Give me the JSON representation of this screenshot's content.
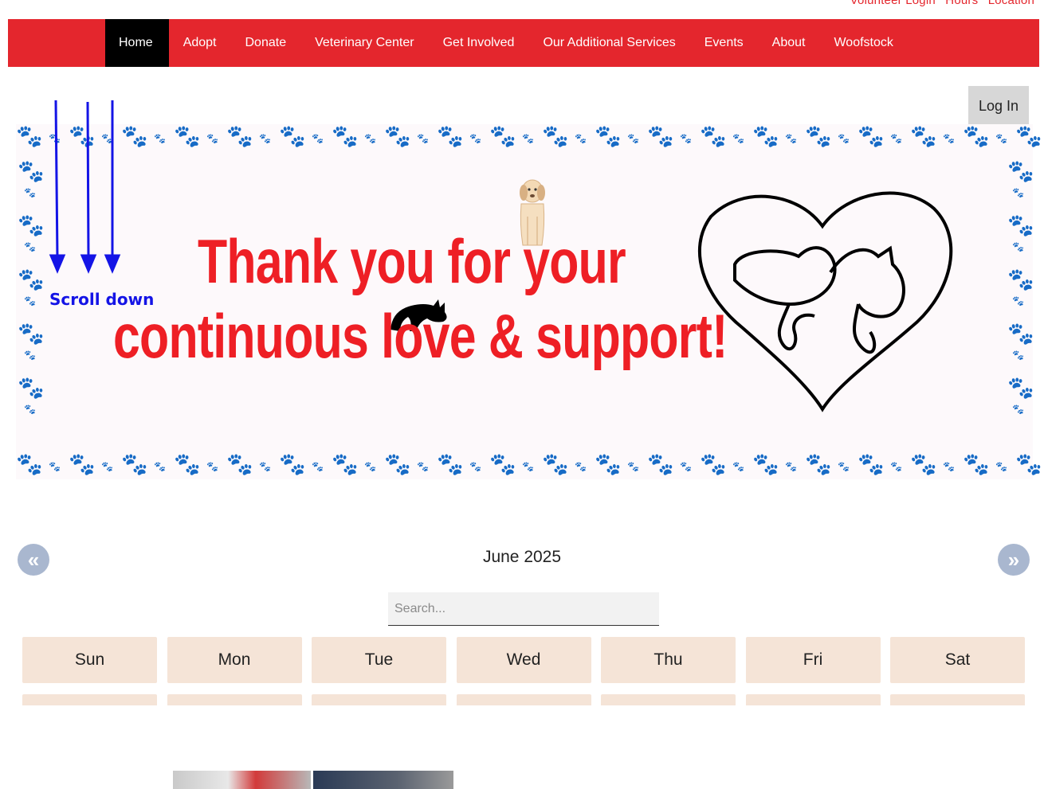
{
  "top_links": [
    "Volunteer Login",
    "Hours",
    "Location"
  ],
  "nav": {
    "items": [
      {
        "label": "Home",
        "active": true
      },
      {
        "label": "Adopt"
      },
      {
        "label": "Donate"
      },
      {
        "label": "Veterinary Center"
      },
      {
        "label": "Get Involved"
      },
      {
        "label": "Our Additional Services"
      },
      {
        "label": "Events"
      },
      {
        "label": "About"
      },
      {
        "label": "Woofstock"
      }
    ]
  },
  "login_label": "Log In",
  "banner": {
    "line1": "Thank you for your",
    "line2": "continuous love & support!"
  },
  "scroll_hint": "Scroll down",
  "calendar": {
    "month": "June 2025",
    "prev": "«",
    "next": "»",
    "search_placeholder": "Search...",
    "weekdays": [
      "Sun",
      "Mon",
      "Tue",
      "Wed",
      "Thu",
      "Fri",
      "Sat"
    ]
  },
  "colors": {
    "brand_red": "#e4262d",
    "nav_active": "#000000",
    "scroll_blue": "#1414e6",
    "weekday_bg": "#f5e4d7"
  }
}
